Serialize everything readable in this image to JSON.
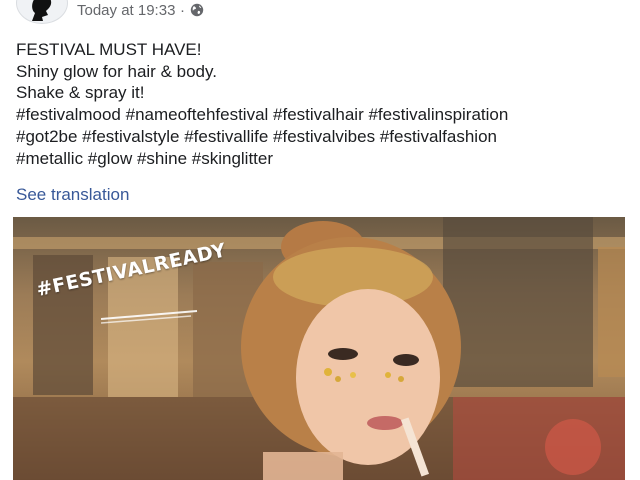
{
  "header": {
    "timestamp": "Today at 19:33",
    "separator": "·",
    "privacy_icon": "globe-icon"
  },
  "post": {
    "lines": [
      "FESTIVAL MUST HAVE!",
      "Shiny glow for hair & body.",
      "Shake & spray it!",
      "#festivalmood #nameoftehfestival #festivalhair #festivalinspiration",
      "#got2be #festivalstyle #festivallife #festivalvibes #festivalfashion",
      "#metallic #glow #shine #skinglitter"
    ],
    "see_translation": "See translation"
  },
  "photo": {
    "overlay_text": "#FESTIVALREADY"
  },
  "colors": {
    "link": "#385898",
    "meta": "#65676b",
    "text": "#1c1e21"
  }
}
